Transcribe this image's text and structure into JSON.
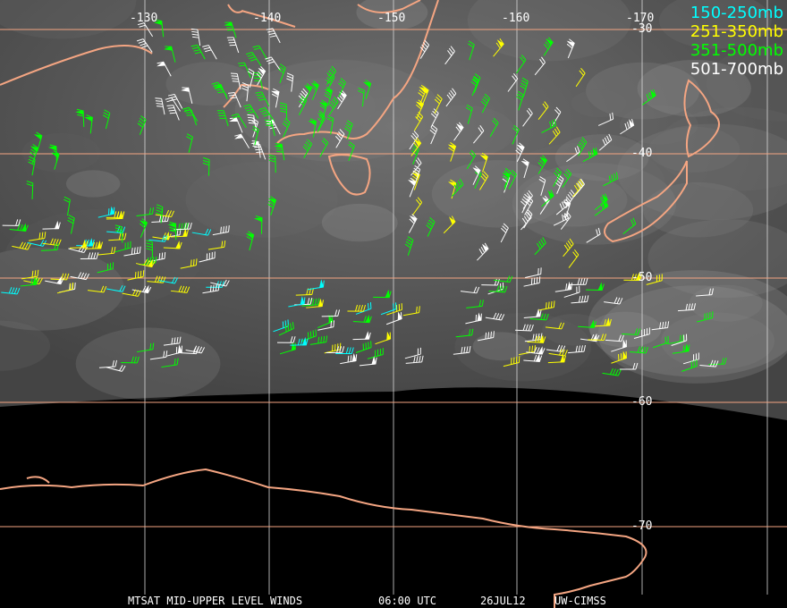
{
  "title": "MTSAT MID-UPPER LEVEL WINDS",
  "caption": {
    "product": "MTSAT MID-UPPER LEVEL WINDS",
    "time": "06:00 UTC",
    "date": "26JUL12",
    "source": "UW-CIMSS"
  },
  "legend": [
    {
      "label": "150-250mb",
      "color": "#00ffff"
    },
    {
      "label": "251-350mb",
      "color": "#ffff00"
    },
    {
      "label": "351-500mb",
      "color": "#00ff00"
    },
    {
      "label": "501-700mb",
      "color": "#ffffff"
    }
  ],
  "grid": {
    "longitude_labels": [
      "-130",
      "-140",
      "-150",
      "-160",
      "-170"
    ],
    "latitude_labels": [
      "-30",
      "-40",
      "-50",
      "-60",
      "-70"
    ],
    "line_color": "#f4a582"
  }
}
